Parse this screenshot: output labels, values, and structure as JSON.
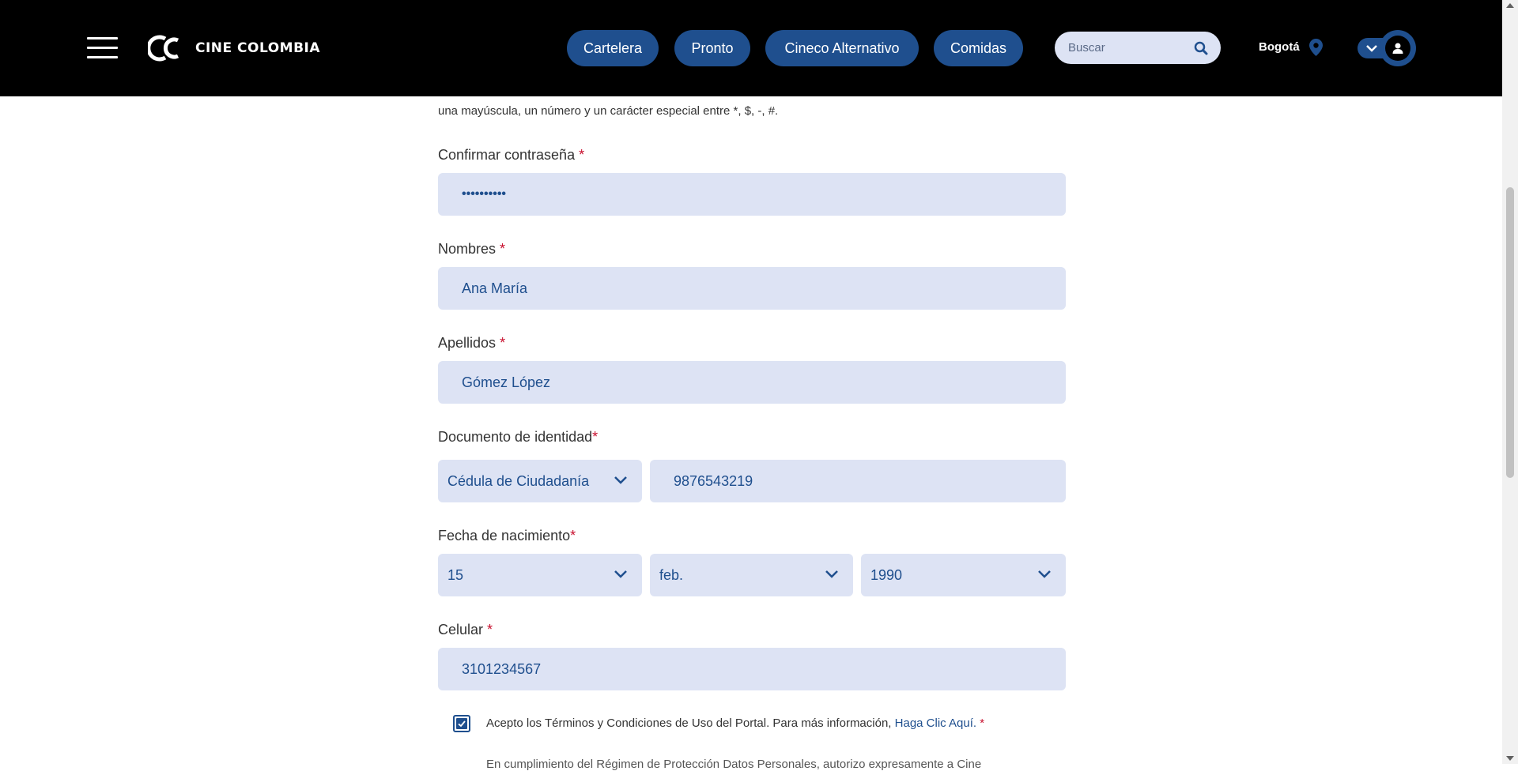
{
  "header": {
    "brand": "CINE COLOMBIA",
    "nav": [
      {
        "label": "Cartelera"
      },
      {
        "label": "Pronto"
      },
      {
        "label": "Cineco Alternativo"
      },
      {
        "label": "Comidas"
      }
    ],
    "search_placeholder": "Buscar",
    "city": "Bogotá"
  },
  "form": {
    "password_hint": "una mayúscula, un número y un carácter especial entre *, $, -, #.",
    "confirm_password": {
      "label": "Confirmar contraseña",
      "required": "*",
      "value": "••••••••••"
    },
    "first_names": {
      "label": "Nombres",
      "required": "*",
      "value": "Ana María"
    },
    "last_names": {
      "label": "Apellidos",
      "required": "*",
      "value": "Gómez López"
    },
    "id_document": {
      "label": "Documento de identidad",
      "required": "*",
      "type_value": "Cédula de Ciudadanía",
      "number_value": "9876543219"
    },
    "birth_date": {
      "label": "Fecha de nacimiento",
      "required": "*",
      "day": "15",
      "month": "feb.",
      "year": "1990"
    },
    "mobile": {
      "label": "Celular",
      "required": "*",
      "value": "3101234567"
    },
    "terms": {
      "checked": true,
      "text": "Acepto los Términos y Condiciones de Uso del Portal. Para más información, ",
      "link": "Haga Clic Aquí.",
      "required": "*"
    },
    "data_protection_text": "En cumplimiento del Régimen de Protección Datos Personales, autorizo expresamente a Cine"
  },
  "colors": {
    "header_bg": "#000000",
    "accent": "#1f4f8e",
    "field_bg": "#dde3f4",
    "required": "#c8102e"
  }
}
